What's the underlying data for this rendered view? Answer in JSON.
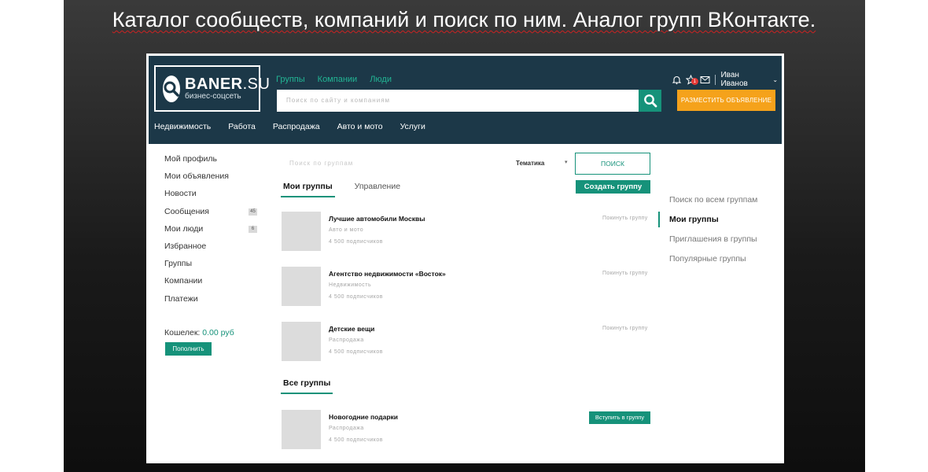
{
  "slide": {
    "title": "Каталог сообществ, компаний и поиск по ним. Аналог групп ВКонтакте."
  },
  "logo": {
    "brand": "BANER",
    "brand_suffix": ".SU",
    "tagline": "бизнес-соцсеть",
    "icon": "search-magnifier"
  },
  "top_nav": [
    "Группы",
    "Компании",
    "Люди"
  ],
  "search": {
    "placeholder": "Поиск по сайту и компаниям"
  },
  "user_bar": {
    "icons": [
      "bell-icon",
      "star-icon",
      "mail-icon"
    ],
    "star_badge": "1",
    "name": "Иван Иванов"
  },
  "post_ad_button": "РАЗМЕСТИТЬ ОБЪЯВЛЕНИЕ",
  "categories": [
    "Недвижимость",
    "Работа",
    "Распродажа",
    "Авто и мото",
    "Услуги"
  ],
  "sidebar": {
    "items": [
      {
        "label": "Мой профиль",
        "count": ""
      },
      {
        "label": "Мои объявления",
        "count": ""
      },
      {
        "label": "Новости",
        "count": ""
      },
      {
        "label": "Сообщения",
        "count": "45"
      },
      {
        "label": "Мои люди",
        "count": "6"
      },
      {
        "label": "Избранное",
        "count": ""
      },
      {
        "label": "Группы",
        "count": ""
      },
      {
        "label": "Компании",
        "count": ""
      },
      {
        "label": "Платежи",
        "count": ""
      }
    ],
    "wallet_label": "Кошелек:",
    "wallet_amount": "0.00 руб",
    "topup_button": "Пополнить"
  },
  "filters": {
    "search_placeholder": "Поиск по группам",
    "topic_label": "Тематика",
    "find_button": "ПОИСК"
  },
  "tabs": [
    {
      "label": "Мои группы",
      "active": true
    },
    {
      "label": "Управление",
      "active": false
    }
  ],
  "create_group_button": "Создать группу",
  "my_groups": [
    {
      "name": "Лучшие автомобили Москвы",
      "category": "Авто и мото",
      "subscribers": "4 500 подписчиков",
      "action": "Покинуть группу"
    },
    {
      "name": "Агентство недвижимости «Восток»",
      "category": "Недвижимость",
      "subscribers": "4 500 подписчиков",
      "action": "Покинуть группу"
    },
    {
      "name": "Детские вещи",
      "category": "Распродажа",
      "subscribers": "4 500 подписчиков",
      "action": "Покинуть группу"
    }
  ],
  "all_groups_title": "Все группы",
  "all_groups": [
    {
      "name": "Новогодние подарки",
      "category": "Распродажа",
      "subscribers": "4 500 подписчиков",
      "action": "Вступить в группу"
    }
  ],
  "right_nav": [
    {
      "label": "Поиск по всем группам",
      "active": false
    },
    {
      "label": "Мои группы",
      "active": true
    },
    {
      "label": "Приглашения в группы",
      "active": false
    },
    {
      "label": "Популярные группы",
      "active": false
    }
  ],
  "colors": {
    "header_bg": "#1c3848",
    "accent": "#16927a",
    "link": "#22b594",
    "orange": "#f5a21b"
  }
}
